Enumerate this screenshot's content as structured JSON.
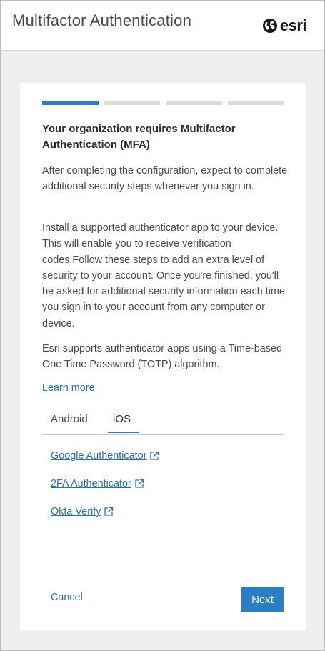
{
  "header": {
    "title": "Multifactor Authentication",
    "logo_text": "esri",
    "logo_icon": "globe-icon"
  },
  "progress": {
    "total_steps": 4,
    "current_step": 1
  },
  "content": {
    "heading": "Your organization requires Multifactor Authentication (MFA)",
    "paragraph1": "After completing the configuration, expect to complete additional security steps whenever you sign in.",
    "paragraph2": "Install a supported authenticator app to your device. This will enable you to receive verification codes.Follow these steps to add an extra level of security to your account. Once you're finished, you'll be asked for additional security information each time you sign in to your account from any computer or device.",
    "paragraph3": "Esri supports authenticator apps using a Time-based One Time Password (TOTP) algorithm.",
    "learn_more": "Learn more"
  },
  "tabs": [
    {
      "label": "Android",
      "selected": false
    },
    {
      "label": "iOS",
      "selected": true
    }
  ],
  "apps": [
    {
      "label": "Google Authenticator",
      "icon": "external-link-icon"
    },
    {
      "label": "2FA Authenticator",
      "icon": "external-link-icon"
    },
    {
      "label": "Okta Verify",
      "icon": "external-link-icon"
    }
  ],
  "actions": {
    "cancel": "Cancel",
    "next": "Next"
  },
  "colors": {
    "accent": "#2b7ec2",
    "link": "#2b6fa8",
    "step_inactive": "#dddddd"
  }
}
